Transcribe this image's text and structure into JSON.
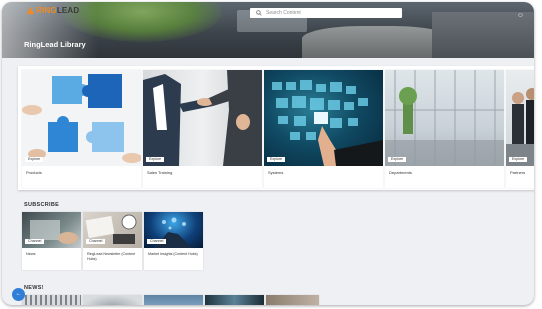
{
  "header": {
    "logo_left": "RING",
    "logo_right": "LEAD",
    "search_placeholder": "Search Content",
    "library_title": "RingLead Library",
    "top_icon": "☺"
  },
  "library": {
    "items": [
      {
        "badge": "Explore",
        "label": "Products"
      },
      {
        "badge": "Explore",
        "label": "Sales Training"
      },
      {
        "badge": "Explore",
        "label": "Systems"
      },
      {
        "badge": "Explore",
        "label": "Departments"
      },
      {
        "badge": "Explore",
        "label": "Partners"
      }
    ]
  },
  "subscribe": {
    "heading": "SUBSCRIBE",
    "items": [
      {
        "badge": "Channel",
        "label": "News"
      },
      {
        "badge": "Channel",
        "label": "RingLead Newsletter (Content Hubs)"
      },
      {
        "badge": "Channel",
        "label": "Market Insights (Content Hubs)"
      }
    ]
  },
  "news": {
    "heading": "NEWS!"
  },
  "fab": {
    "label": "←"
  },
  "icons": [
    "search-icon",
    "help-icon",
    "back-icon"
  ]
}
